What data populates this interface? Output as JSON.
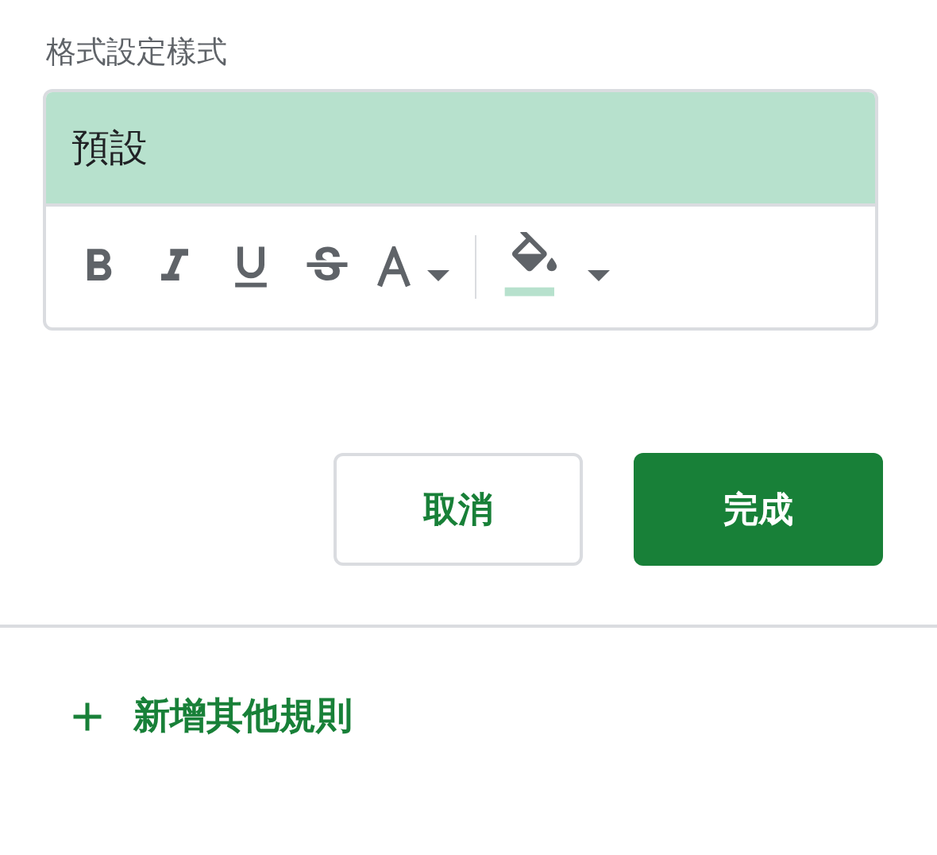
{
  "format_style": {
    "label": "格式設定樣式",
    "preview_text": "預設",
    "color": "#b7e1cd"
  },
  "buttons": [
    {
      "label": "取消",
      "kind": "secondary"
    },
    {
      "label": "完成",
      "kind": "primary"
    }
  ],
  "add_rule": {
    "label": "新增其他規則"
  }
}
